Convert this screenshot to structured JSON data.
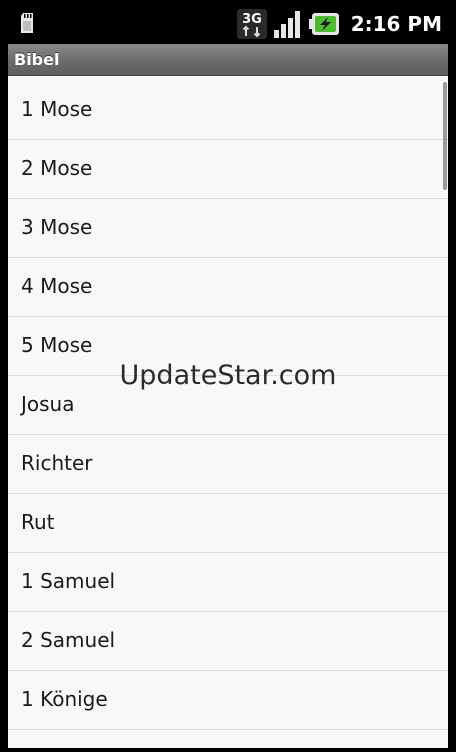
{
  "status_bar": {
    "network_type": "3G",
    "time": "2:16 PM",
    "icons": [
      "sd-card-icon",
      "network-3g-icon",
      "signal-icon",
      "battery-charging-icon"
    ],
    "colors": {
      "battery_fill": "#4dbb33"
    }
  },
  "title_bar": {
    "title": "Bibel"
  },
  "book_list": {
    "items": [
      "1 Mose",
      "2 Mose",
      "3 Mose",
      "4 Mose",
      "5 Mose",
      "Josua",
      "Richter",
      "Rut",
      "1 Samuel",
      "2 Samuel",
      "1 Könige"
    ]
  },
  "watermark": {
    "text": "UpdateStar.com"
  }
}
